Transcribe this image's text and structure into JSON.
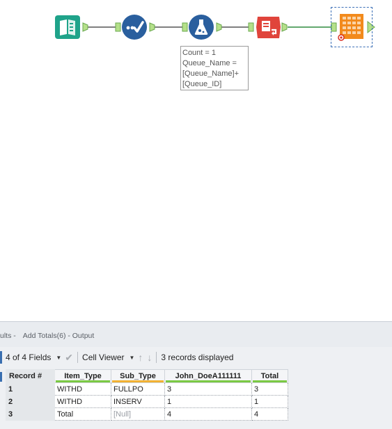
{
  "workflow": {
    "tools": [
      {
        "name": "input-data-tool",
        "color": "#1fa38a"
      },
      {
        "name": "select-tool",
        "color": "#2a5f9e"
      },
      {
        "name": "formula-tool",
        "color": "#2a5f9e"
      },
      {
        "name": "summarize-tool",
        "color": "#e0443b"
      },
      {
        "name": "browse-tool",
        "color": "#f28a1c"
      }
    ],
    "annotation": {
      "line1": "Count = 1",
      "line2": "Queue_Name =",
      "line3": "[Queue_Name]+",
      "line4": "[Queue_ID]"
    }
  },
  "results": {
    "title_prefix": "ults -",
    "title_tool": "Add Totals(6) - Output",
    "fields_label": "4 of 4 Fields",
    "cell_viewer_label": "Cell Viewer",
    "records_status": "3 records displayed",
    "columns": [
      {
        "label": "Record #",
        "bar": ""
      },
      {
        "label": "Item_Type",
        "bar": "#7ac943"
      },
      {
        "label": "Sub_Type",
        "bar": "#f2b233"
      },
      {
        "label": "John_DoeA111111",
        "bar": "#7ac943"
      },
      {
        "label": "Total",
        "bar": "#7ac943"
      }
    ],
    "rows": [
      {
        "rec": "1",
        "item_type": "WITHD",
        "sub_type": "FULLPO",
        "john": "3",
        "total": "3"
      },
      {
        "rec": "2",
        "item_type": "WITHD",
        "sub_type": "INSERV",
        "john": "1",
        "total": "1"
      },
      {
        "rec": "3",
        "item_type": "Total",
        "sub_type": "[Null]",
        "john": "4",
        "total": "4"
      }
    ]
  }
}
